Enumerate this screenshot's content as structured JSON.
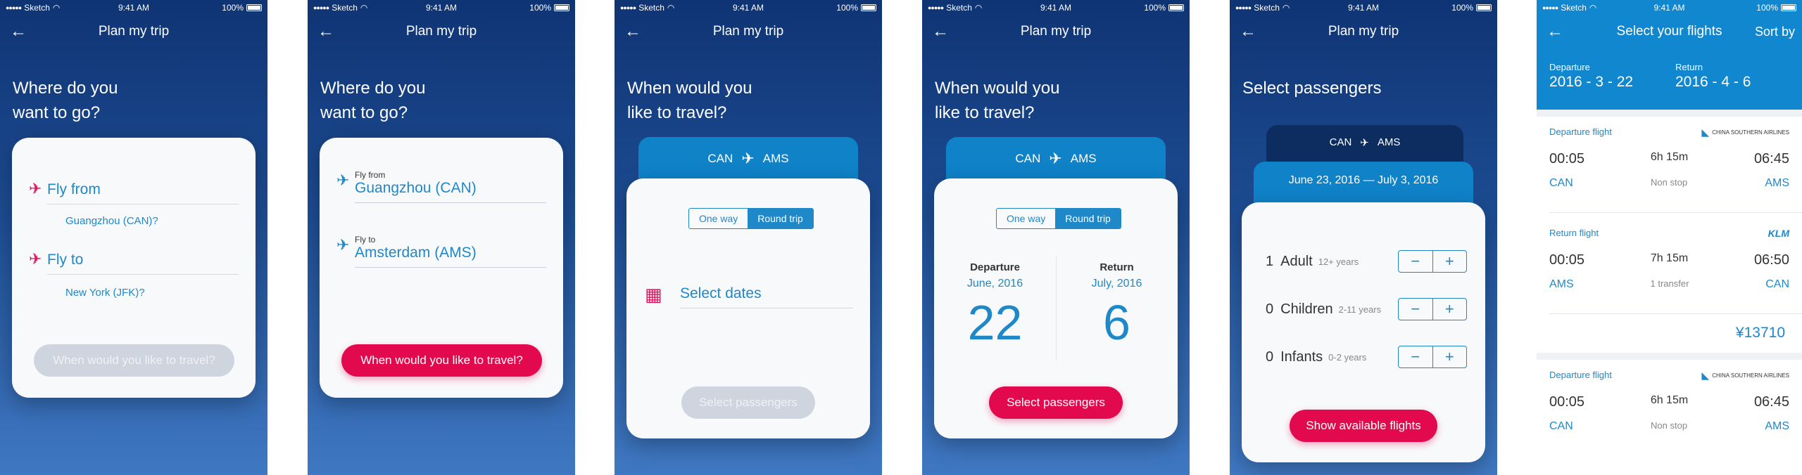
{
  "status": {
    "carrier": "Sketch",
    "time": "9:41 AM",
    "battery": "100%"
  },
  "nav": {
    "title": "Plan my trip",
    "select_flights": "Select your flights",
    "sort": "Sort by"
  },
  "s1": {
    "heading1": "Where do you",
    "heading2": "want to go?",
    "fly_from": "Fly from",
    "from_hint": "Guangzhou (CAN)?",
    "fly_to": "Fly to",
    "to_hint": "New York (JFK)?",
    "btn": "When would you like to travel?"
  },
  "s2": {
    "from_label": "Fly from",
    "from_value": "Guangzhou (CAN)",
    "to_label": "Fly to",
    "to_value": "Amsterdam (AMS)",
    "btn": "When would you like to travel?"
  },
  "s3": {
    "heading1": "When would you",
    "heading2": "like to travel?",
    "origin": "CAN",
    "dest": "AMS",
    "one_way": "One way",
    "round_trip": "Round trip",
    "select_dates": "Select dates",
    "btn": "Select passengers"
  },
  "s4": {
    "departure": "Departure",
    "dep_month": "June, 2016",
    "dep_day": "22",
    "return": "Return",
    "ret_month": "July, 2016",
    "ret_day": "6",
    "btn": "Select passengers"
  },
  "s5": {
    "heading": "Select passengers",
    "dates": "June 23, 2016 — July 3, 2016",
    "rows": [
      {
        "count": "1",
        "type": "Adult",
        "age": "12+ years"
      },
      {
        "count": "0",
        "type": "Children",
        "age": "2-11 years"
      },
      {
        "count": "0",
        "type": "Infants",
        "age": "0-2 years"
      }
    ],
    "btn": "Show available flights"
  },
  "s6": {
    "departure_label": "Departure",
    "departure_date": "2016 - 3 - 22",
    "return_label": "Return",
    "return_date": "2016 - 4 - 6",
    "f1": {
      "label": "Departure flight",
      "airline": "CHINA SOUTHERN AIRLINES",
      "dep": "00:05",
      "dur": "6h 15m",
      "arr": "06:45",
      "from": "CAN",
      "stops": "Non stop",
      "to": "AMS"
    },
    "f2": {
      "label": "Return flight",
      "airline": "KLM",
      "dep": "00:05",
      "dur": "7h 15m",
      "arr": "06:50",
      "from": "AMS",
      "stops": "1 transfer",
      "to": "CAN"
    },
    "price": "¥13710",
    "f3": {
      "label": "Departure flight",
      "airline": "CHINA SOUTHERN AIRLINES",
      "dep": "00:05",
      "dur": "6h 15m",
      "arr": "06:45",
      "from": "CAN",
      "stops": "Non stop",
      "to": "AMS"
    }
  },
  "colors": {
    "accent": "#e3094f",
    "blue": "#1e88c8",
    "navy": "#0f3474"
  }
}
